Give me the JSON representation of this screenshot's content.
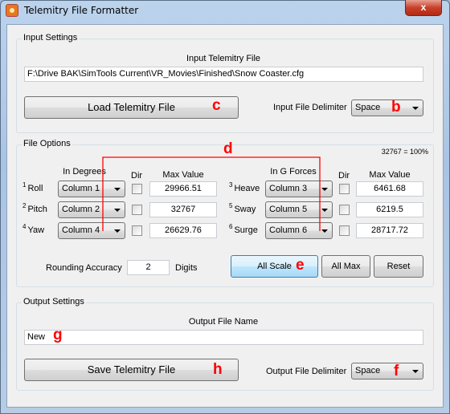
{
  "window": {
    "title": "Telemitry File Formatter",
    "close_label": "x"
  },
  "input_settings": {
    "group_label": "Input Settings",
    "file_label": "Input Telemitry File",
    "file_value": "F:\\Drive BAK\\SimTools Current\\VR_Movies\\Finished\\Snow Coaster.cfg",
    "load_button": "Load Telemitry File",
    "delimiter_label": "Input File Delimiter",
    "delimiter_value": "Space"
  },
  "file_options": {
    "group_label": "File Options",
    "scale_note": "32767 = 100%",
    "left_header": "In Degrees",
    "right_header": "In G Forces",
    "dir_header": "Dir",
    "max_header": "Max Value",
    "left_rows": [
      {
        "num": "1",
        "label": "Roll",
        "column": "Column 1",
        "dir": false,
        "max": "29966.51"
      },
      {
        "num": "2",
        "label": "Pitch",
        "column": "Column 2",
        "dir": false,
        "max": "32767"
      },
      {
        "num": "4",
        "label": "Yaw",
        "column": "Column 4",
        "dir": false,
        "max": "26629.76"
      }
    ],
    "right_rows": [
      {
        "num": "3",
        "label": "Heave",
        "column": "Column 3",
        "dir": false,
        "max": "6461.68"
      },
      {
        "num": "5",
        "label": "Sway",
        "column": "Column 5",
        "dir": false,
        "max": "6219.5"
      },
      {
        "num": "6",
        "label": "Surge",
        "column": "Column 6",
        "dir": false,
        "max": "28717.72"
      }
    ],
    "rounding_label": "Rounding Accuracy",
    "rounding_value": "2",
    "digits_label": "Digits",
    "all_scale": "All Scale",
    "all_max": "All Max",
    "reset": "Reset"
  },
  "output_settings": {
    "group_label": "Output Settings",
    "file_label": "Output File Name",
    "file_value": "New",
    "save_button": "Save Telemitry File",
    "delimiter_label": "Output File Delimiter",
    "delimiter_value": "Space"
  },
  "annotations": {
    "b": "b",
    "c": "c",
    "d": "d",
    "e": "e",
    "f": "f",
    "g": "g",
    "h": "h",
    "color": "#ff0000"
  }
}
